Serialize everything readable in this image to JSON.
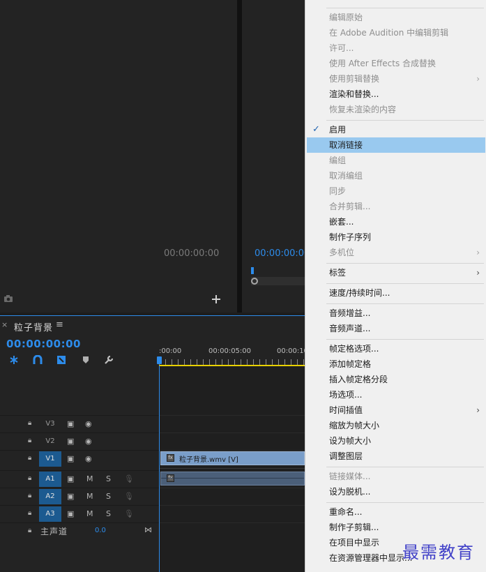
{
  "source_monitor": {
    "timecode": "00:00:00:00",
    "camera_icon": "camera-icon",
    "add_icon": "plus-icon"
  },
  "program_monitor": {
    "timecode": "00:00:00:00"
  },
  "timeline": {
    "close_glyph": "×",
    "sequence_name": "粒子背景",
    "menu_glyph": "≡",
    "timecode": "00:00:00:00",
    "ruler_labels": [
      ":00:00",
      "00:00:05:00",
      "00:00:10"
    ],
    "tracks": [
      {
        "name": "V3",
        "active": false
      },
      {
        "name": "V2",
        "active": false
      },
      {
        "name": "V1",
        "active": true
      },
      {
        "name": "A1",
        "active": true
      },
      {
        "name": "A2",
        "active": true
      },
      {
        "name": "A3",
        "active": true
      }
    ],
    "track_m": "M",
    "track_s": "S",
    "master_label": "主声道",
    "master_value": "0.0",
    "clip_video_label": "粒子背景.wmv [V]",
    "clip_fx": "fx"
  },
  "menu": {
    "items": [
      {
        "label": "编辑原始",
        "disabled": true
      },
      {
        "label": "在 Adobe Audition 中编辑剪辑",
        "disabled": true
      },
      {
        "label": "许可...",
        "disabled": true
      },
      {
        "label": "使用 After Effects 合成替换",
        "disabled": true
      },
      {
        "label": "使用剪辑替换",
        "disabled": true,
        "submenu": true
      },
      {
        "label": "渲染和替换...",
        "disabled": false
      },
      {
        "label": "恢复未渲染的内容",
        "disabled": true
      },
      {
        "label": "启用",
        "disabled": false,
        "checked": true
      },
      {
        "label": "取消链接",
        "disabled": false,
        "highlight": true
      },
      {
        "label": "编组",
        "disabled": true
      },
      {
        "label": "取消编组",
        "disabled": true
      },
      {
        "label": "同步",
        "disabled": true
      },
      {
        "label": "合并剪辑...",
        "disabled": true
      },
      {
        "label": "嵌套...",
        "disabled": false
      },
      {
        "label": "制作子序列",
        "disabled": false
      },
      {
        "label": "多机位",
        "disabled": true,
        "submenu": true
      },
      {
        "label": "标签",
        "disabled": false,
        "submenu": true
      },
      {
        "label": "速度/持续时间...",
        "disabled": false
      },
      {
        "label": "音频增益...",
        "disabled": false
      },
      {
        "label": "音频声道...",
        "disabled": false
      },
      {
        "label": "帧定格选项...",
        "disabled": false
      },
      {
        "label": "添加帧定格",
        "disabled": false
      },
      {
        "label": "插入帧定格分段",
        "disabled": false
      },
      {
        "label": "场选项...",
        "disabled": false
      },
      {
        "label": "时间插值",
        "disabled": false,
        "submenu": true
      },
      {
        "label": "缩放为帧大小",
        "disabled": false
      },
      {
        "label": "设为帧大小",
        "disabled": false
      },
      {
        "label": "调整图层",
        "disabled": false
      },
      {
        "label": "链接媒体...",
        "disabled": true
      },
      {
        "label": "设为脱机...",
        "disabled": false
      },
      {
        "label": "重命名...",
        "disabled": false
      },
      {
        "label": "制作子剪辑...",
        "disabled": false
      },
      {
        "label": "在项目中显示",
        "disabled": false
      },
      {
        "label": "在资源管理器中显示...",
        "disabled": false
      }
    ],
    "submenu_glyph": "›",
    "check_glyph": "✓"
  },
  "watermark": "最需教育",
  "colors": {
    "accent": "#2d8ceb",
    "menu_highlight": "#99c9ef",
    "ruler_yellow": "#e8d100"
  }
}
